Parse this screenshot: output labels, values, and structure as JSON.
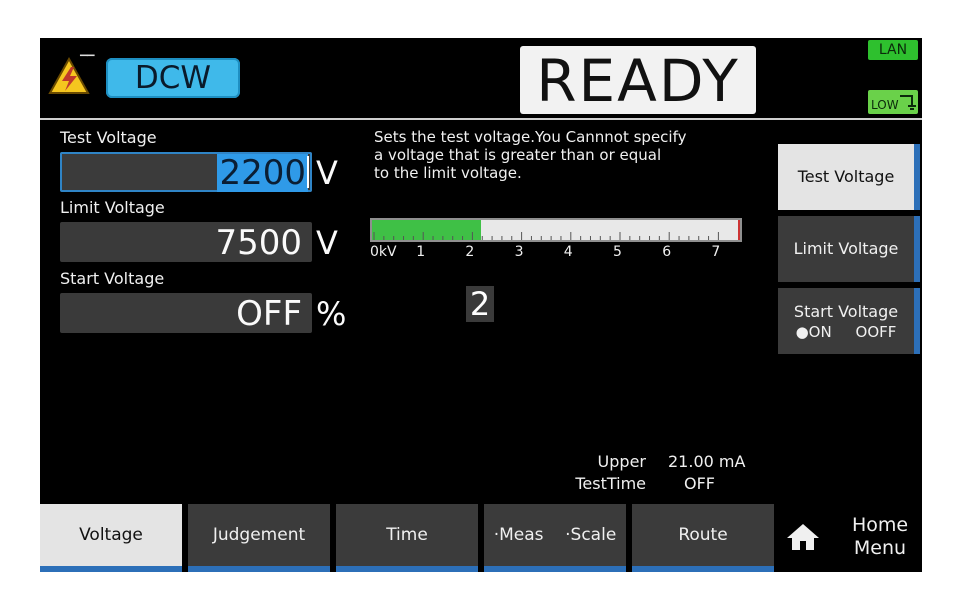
{
  "header": {
    "mode": "DCW",
    "status": "READY",
    "lan": "LAN",
    "low": "LOW",
    "warning_icon": "high-voltage-warning-icon"
  },
  "fields": {
    "test_voltage": {
      "label": "Test Voltage",
      "value": "2200",
      "unit": "V"
    },
    "limit_voltage": {
      "label": "Limit Voltage",
      "value": "7500",
      "unit": "V"
    },
    "start_voltage": {
      "label": "Start Voltage",
      "value": "OFF",
      "unit": "%"
    }
  },
  "help_text": "Sets the test voltage.You Cannnot specify\na voltage that is greater than or equal\nto the limit voltage.",
  "bar": {
    "fill_fraction": 0.296,
    "ticks": [
      "0kV",
      "1",
      "2",
      "3",
      "4",
      "5",
      "6",
      "7"
    ]
  },
  "cursor_digit": "2",
  "info": {
    "upper_label": "Upper",
    "upper_value": "21.00 mA",
    "testtime_label": "TestTime",
    "testtime_value": "OFF"
  },
  "side_buttons": {
    "test_voltage": "Test Voltage",
    "limit_voltage": "Limit Voltage",
    "start_voltage": "Start Voltage",
    "on": "●ON",
    "off": "OOFF"
  },
  "tabs": {
    "voltage": "Voltage",
    "judgement": "Judgement",
    "time": "Time",
    "meas": "·Meas",
    "scale": "·Scale",
    "route": "Route"
  },
  "home": {
    "line1": "Home",
    "line2": "Menu"
  },
  "colors": {
    "accent_blue": "#3fb9ea",
    "bar_green": "#3fc046",
    "tab_blue": "#2c6fb8"
  }
}
